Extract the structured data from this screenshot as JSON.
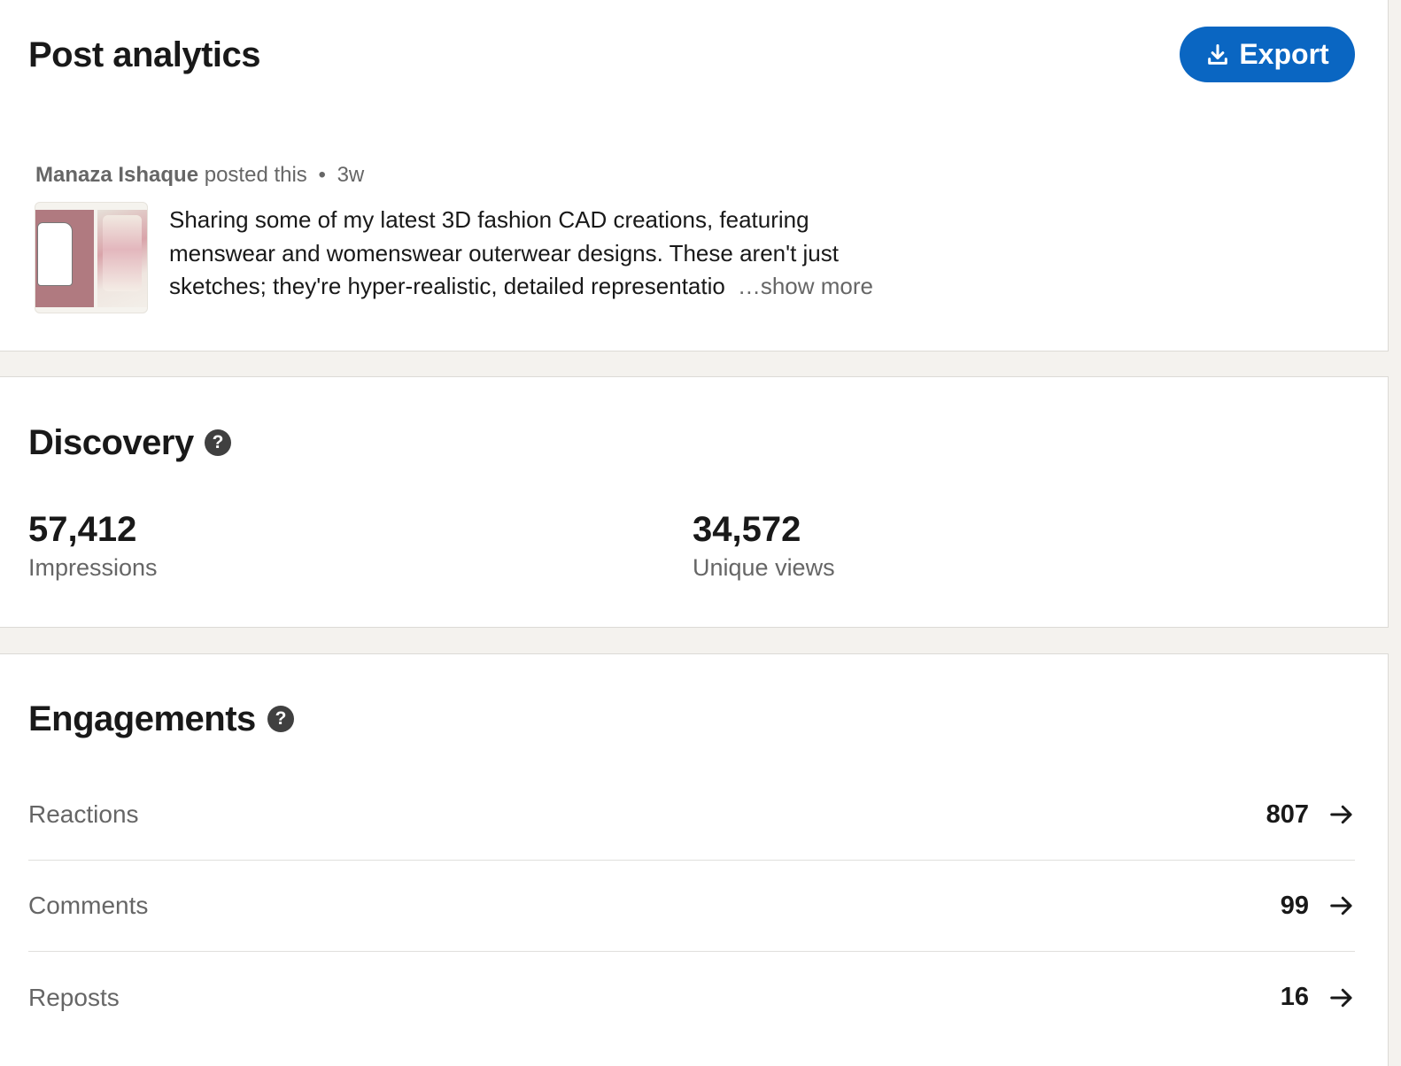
{
  "header": {
    "title": "Post analytics",
    "export_label": "Export"
  },
  "post": {
    "author": "Manaza Ishaque",
    "action": "posted this",
    "separator": "•",
    "age": "3w",
    "text_lines": [
      "Sharing some of my latest 3D fashion CAD creations, featuring",
      "menswear and womenswear outerwear designs. These aren't just",
      "sketches; they're hyper-realistic, detailed representatio"
    ],
    "show_more": "…show more"
  },
  "discovery": {
    "title": "Discovery",
    "help": "?",
    "metrics": [
      {
        "value": "57,412",
        "label": "Impressions"
      },
      {
        "value": "34,572",
        "label": "Unique views"
      }
    ]
  },
  "engagements": {
    "title": "Engagements",
    "help": "?",
    "rows": [
      {
        "label": "Reactions",
        "count": "807"
      },
      {
        "label": "Comments",
        "count": "99"
      },
      {
        "label": "Reposts",
        "count": "16"
      }
    ]
  },
  "colors": {
    "accent": "#0a66c2",
    "page_bg": "#f4f2ee",
    "muted_text": "#666666",
    "primary_text": "#191919"
  },
  "icons": {
    "export": "download-icon",
    "help": "question-circle-icon",
    "row_arrow": "arrow-right-icon"
  }
}
